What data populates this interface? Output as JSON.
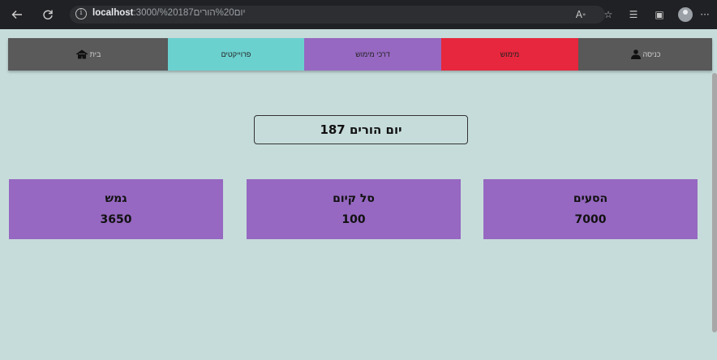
{
  "browser": {
    "url_host": "localhost",
    "url_path": ":3000/%20187יום%20הורים"
  },
  "nav": {
    "items": [
      {
        "label": "בית"
      },
      {
        "label": "פרוייקטים"
      },
      {
        "label": "דרכי מימוש"
      },
      {
        "label": "מימוש"
      },
      {
        "label": "כניסה"
      }
    ]
  },
  "page": {
    "title": "יום הורים 187"
  },
  "cards": [
    {
      "label": "גמש",
      "value": "3650"
    },
    {
      "label": "סל קיום",
      "value": "100"
    },
    {
      "label": "הסעים",
      "value": "7000"
    }
  ],
  "colors": {
    "background": "#c6dcdb",
    "nav_home": "#5a5a5a",
    "nav_projects": "#6bd1cf",
    "nav_guides": "#9668c1",
    "nav_funding": "#e6273d",
    "nav_login": "#595959",
    "card": "#9668c1"
  }
}
